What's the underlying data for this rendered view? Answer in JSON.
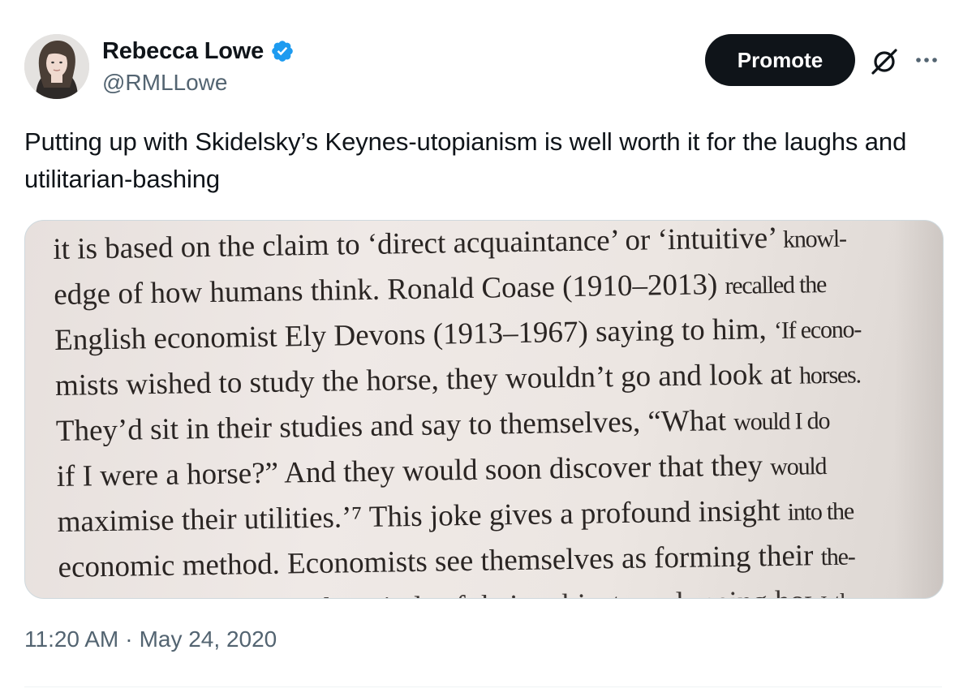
{
  "author": {
    "display_name": "Rebecca Lowe",
    "handle": "@RMLLowe",
    "verified": true,
    "avatar_icon": "avatar-photo"
  },
  "actions": {
    "promote_label": "Promote",
    "promote_icon": "slashed-circle-icon",
    "more_icon": "more-horizontal-icon"
  },
  "tweet": {
    "text": "Putting up with Skidelsky’s Keynes-utopianism is well worth it for the laughs and utilitarian-bashing"
  },
  "media": {
    "type": "photo-of-book-page",
    "lines": [
      [
        "it is based on the claim to ‘direct acquaintance’ or ‘intuitive’ ",
        "knowl-"
      ],
      [
        "edge of how humans think. Ronald Coase (1910–2013) ",
        "recalled the"
      ],
      [
        "English economist Ely Devons (1913–1967) saying to him, ",
        "‘If econo-"
      ],
      [
        "mists wished to study the horse, they wouldn’t go and look at ",
        "horses."
      ],
      [
        "They’d sit in their studies and say to themselves, “What ",
        "would I do"
      ],
      [
        "if I were a horse?” And they would soon discover that they ",
        "would"
      ],
      [
        "maximise their utilities.’⁷ This joke gives a profound insight ",
        "into the"
      ],
      [
        "economic method. Economists see themselves as forming their ",
        "the-"
      ],
      [
        "ories by looking into the minds of their subjects and seeing how ",
        "they"
      ]
    ]
  },
  "meta": {
    "time": "11:20 AM",
    "separator": "·",
    "date": "May 24, 2020"
  },
  "colors": {
    "text_primary": "#0f1419",
    "text_secondary": "#536471",
    "verified_blue": "#1d9bf0",
    "button_bg": "#0f1419"
  }
}
